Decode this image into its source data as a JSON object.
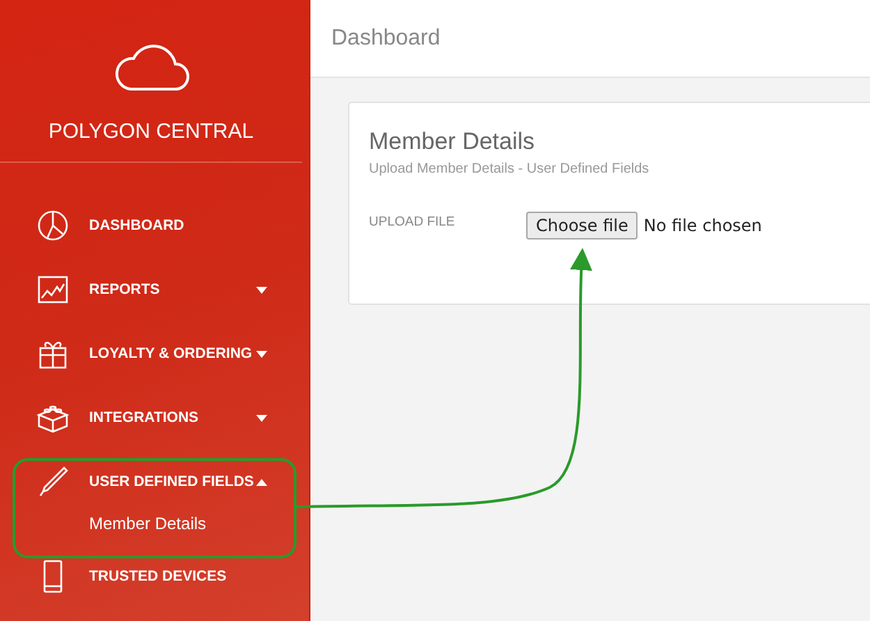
{
  "sidebar": {
    "brand": "POLYGON CENTRAL",
    "items": [
      {
        "label": "DASHBOARD"
      },
      {
        "label": "REPORTS",
        "expanded": false
      },
      {
        "label": "LOYALTY & ORDERING",
        "expanded": false
      },
      {
        "label": "INTEGRATIONS",
        "expanded": false
      },
      {
        "label": "USER DEFINED FIELDS",
        "expanded": true,
        "children": [
          {
            "label": "Member Details"
          }
        ]
      },
      {
        "label": "TRUSTED DEVICES"
      }
    ]
  },
  "header": {
    "title": "Dashboard"
  },
  "card": {
    "title": "Member Details",
    "subtitle": "Upload Member Details - User Defined Fields",
    "field_label": "UPLOAD FILE",
    "button": "Choose file",
    "file_status": "No file chosen"
  }
}
